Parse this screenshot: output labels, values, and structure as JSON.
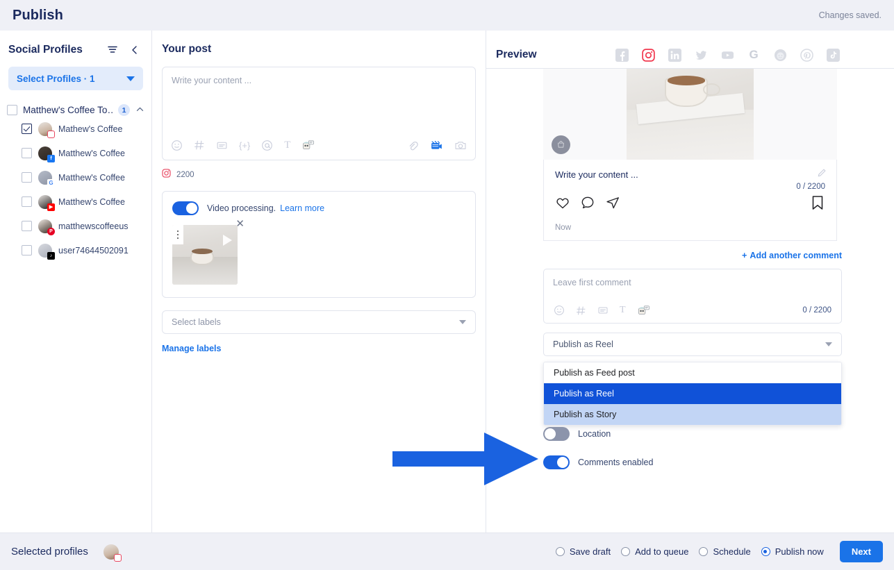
{
  "header": {
    "title": "Publish",
    "status": "Changes saved."
  },
  "sidebar": {
    "title": "Social Profiles",
    "filter_icon": "filter-icon",
    "collapse_icon": "chevron-left-icon",
    "select_profiles_label": "Select Profiles · 1",
    "group": {
      "name": "Matthew's Coffee To…",
      "count": "1",
      "checked": false
    },
    "profiles": [
      {
        "name": "Mathew's Coffee",
        "network": "instagram",
        "checked": true
      },
      {
        "name": "Matthew's Coffee",
        "network": "facebook",
        "checked": false
      },
      {
        "name": "Matthew's Coffee",
        "network": "google",
        "checked": false
      },
      {
        "name": "Matthew's Coffee",
        "network": "youtube",
        "checked": false
      },
      {
        "name": "matthewscoffeeus",
        "network": "pinterest",
        "checked": false
      },
      {
        "name": "user74644502091",
        "network": "tiktok",
        "checked": false
      }
    ]
  },
  "post": {
    "title": "Your post",
    "editor_placeholder": "Write your content ...",
    "toolbar_left": [
      "emoji-icon",
      "hashtag-icon",
      "saved-reply-icon",
      "variable-icon",
      "mention-icon",
      "text-format-icon",
      "ai-assistant-icon"
    ],
    "toolbar_right": [
      "link-icon",
      "video-icon",
      "camera-icon"
    ],
    "char_limit_network": "instagram",
    "char_limit": "2200",
    "video_processing": {
      "label": "Video processing.",
      "link": "Learn more",
      "enabled": true
    },
    "thumbnail": {
      "menu_icon": "more-vertical-icon",
      "play_icon": "play-icon",
      "remove_icon": "close-icon"
    },
    "labels_placeholder": "Select labels",
    "manage_labels": "Manage labels"
  },
  "preview": {
    "title": "Preview",
    "networks": [
      {
        "name": "facebook",
        "active": false
      },
      {
        "name": "instagram",
        "active": true
      },
      {
        "name": "linkedin",
        "active": false
      },
      {
        "name": "twitter",
        "active": false
      },
      {
        "name": "youtube",
        "active": false
      },
      {
        "name": "google",
        "active": false
      },
      {
        "name": "reddit",
        "active": false
      },
      {
        "name": "pinterest",
        "active": false
      },
      {
        "name": "tiktok",
        "active": false
      }
    ],
    "card": {
      "shop_icon": "shopping-bag-icon",
      "caption": "Write your content ...",
      "edit_icon": "pencil-icon",
      "counter": "0 / 2200",
      "actions": [
        "heart-icon",
        "comment-icon",
        "share-icon",
        "bookmark-icon"
      ],
      "time": "Now"
    },
    "add_another_comment": "Add another comment",
    "comment_box": {
      "placeholder": "Leave first comment",
      "toolbar": [
        "emoji-icon",
        "hashtag-icon",
        "saved-reply-icon",
        "text-format-icon",
        "ai-assistant-icon"
      ],
      "counter": "0 / 2200"
    },
    "publish_select": {
      "value": "Publish as Reel"
    },
    "dropdown_options": [
      {
        "label": "Publish as Feed post",
        "state": "normal"
      },
      {
        "label": "Publish as Reel",
        "state": "selected"
      },
      {
        "label": "Publish as Story",
        "state": "hover"
      }
    ],
    "options": [
      {
        "label": "Location",
        "enabled": false
      },
      {
        "label": "Comments enabled",
        "enabled": true
      }
    ]
  },
  "footer": {
    "selected_profiles_label": "Selected profiles",
    "radios": [
      {
        "label": "Save draft",
        "selected": false
      },
      {
        "label": "Add to queue",
        "selected": false
      },
      {
        "label": "Schedule",
        "selected": false
      },
      {
        "label": "Publish now",
        "selected": true
      }
    ],
    "next_label": "Next"
  },
  "annotation": {
    "arrow_color": "#1a62e0"
  },
  "colors": {
    "accent": "#1a73e8",
    "selected_blue": "#1052d8",
    "hover_blue": "#c2d5f5",
    "instagram_red": "#e8455f",
    "navy": "#1b2a5e"
  }
}
